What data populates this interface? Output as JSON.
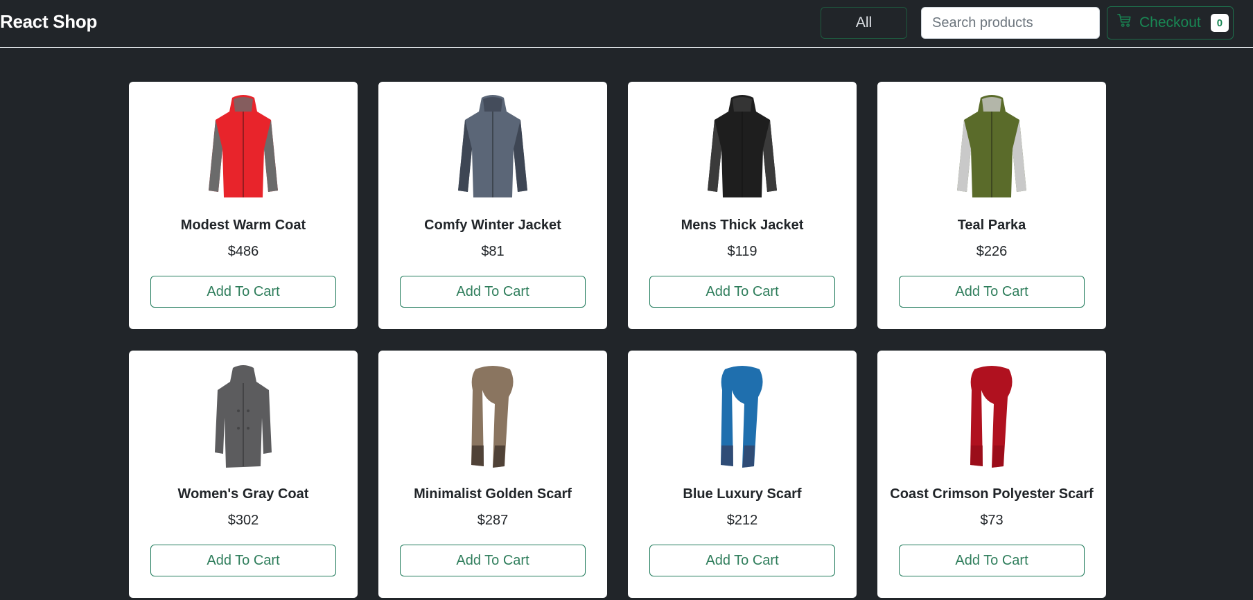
{
  "header": {
    "brand": "React Shop",
    "filter_label": "All",
    "search_placeholder": "Search products",
    "checkout_label": "Checkout",
    "cart_count": "0",
    "cart_icon": "cart-icon"
  },
  "colors": {
    "background": "#212529",
    "accent": "#198754",
    "card": "#ffffff"
  },
  "products": [
    {
      "name": "Modest Warm Coat",
      "price": "$486",
      "button": "Add To Cart",
      "image": "red-jacket",
      "color": "#e8242b",
      "secondary": "#6b6b6b",
      "kind": "jacket"
    },
    {
      "name": "Comfy Winter Jacket",
      "price": "$81",
      "button": "Add To Cart",
      "image": "gray-blue-jacket",
      "color": "#5b6677",
      "secondary": "#3e4654",
      "kind": "jacket"
    },
    {
      "name": "Mens Thick Jacket",
      "price": "$119",
      "button": "Add To Cart",
      "image": "black-jacket",
      "color": "#1e1e1e",
      "secondary": "#3a3a3a",
      "kind": "jacket"
    },
    {
      "name": "Teal Parka",
      "price": "$226",
      "button": "Add To Cart",
      "image": "olive-parka",
      "color": "#5a6b2a",
      "secondary": "#c9c9c9",
      "kind": "jacket"
    },
    {
      "name": "Women's Gray Coat",
      "price": "$302",
      "button": "Add To Cart",
      "image": "gray-coat",
      "color": "#5c5c5e",
      "secondary": "#444446",
      "kind": "coat"
    },
    {
      "name": "Minimalist Golden Scarf",
      "price": "$287",
      "button": "Add To Cart",
      "image": "brown-scarf",
      "color": "#8a7560",
      "secondary": "#2a201c",
      "kind": "scarf"
    },
    {
      "name": "Blue Luxury Scarf",
      "price": "$212",
      "button": "Add To Cart",
      "image": "blue-plaid-scarf",
      "color": "#1f6fae",
      "secondary": "#3a3550",
      "kind": "scarf"
    },
    {
      "name": "Coast Crimson Polyester Scarf",
      "price": "$73",
      "button": "Add To Cart",
      "image": "red-scarf",
      "color": "#b0111f",
      "secondary": "#8d0c18",
      "kind": "scarf"
    }
  ]
}
